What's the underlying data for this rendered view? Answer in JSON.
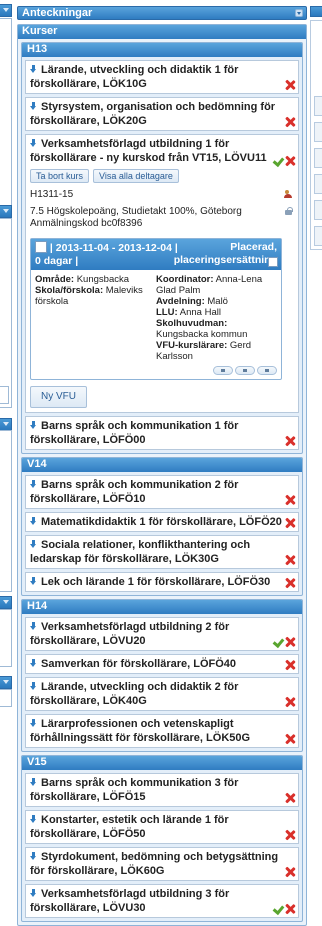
{
  "header": {
    "title": "Anteckningar"
  },
  "panel": {
    "title": "Kurser"
  },
  "terms": [
    {
      "name": "H13",
      "courses": [
        {
          "title": "Lärande, utveckling och didaktik 1 för förskollärare, LÖK10G",
          "approved": false
        },
        {
          "title": "Styrsystem, organisation och bedömning för förskollärare, LÖK20G",
          "approved": false
        }
      ]
    }
  ],
  "expanded_course": {
    "title": "Verksamhetsförlagd utbildning 1 för förskollärare - ny kurskod från VT15, LÖVU11",
    "approved": true,
    "buttons": {
      "remove": "Ta bort kurs",
      "show_participants": "Visa alla deltagare"
    },
    "code": "H1311-15",
    "details": "7.5 Högskolepoäng, Studietakt 100%, Göteborg",
    "registration_code": "Anmälningskod bc0f8396",
    "placement": {
      "dates": "| 2013-11-04 - 2013-12-04 | 0 dagar |",
      "status": "Placerad, placeringsersättning",
      "left": [
        {
          "label": "Område:",
          "value": "Kungsbacka"
        },
        {
          "label": "Skola/förskola:",
          "value": "Maleviks förskola"
        }
      ],
      "right": [
        {
          "label": "Koordinator:",
          "value": "Anna-Lena Glad Palm"
        },
        {
          "label": "Avdelning:",
          "value": "Malö"
        },
        {
          "label": "LLU:",
          "value": "Anna Hall"
        },
        {
          "label": "Skolhuvudman:",
          "value": "Kungsbacka kommun"
        },
        {
          "label": "VFU-kurslärare:",
          "value": "Gerd Karlsson"
        }
      ]
    },
    "new_vfu_button": "Ny VFU"
  },
  "after_expanded": [
    {
      "title": "Barns språk och kommunikation 1 för förskollärare, LÖFÖ00",
      "approved": false
    }
  ],
  "more_terms": [
    {
      "name": "V14",
      "courses": [
        {
          "title": "Barns språk och kommunikation 2 för förskollärare, LÖFÖ10",
          "approved": false
        },
        {
          "title": "Matematikdidaktik 1 för förskollärare, LÖFÖ20",
          "approved": false
        },
        {
          "title": "Sociala relationer, konflikthantering och ledarskap för förskollärare, LÖK30G",
          "approved": false
        },
        {
          "title": "Lek och lärande 1 för förskollärare, LÖFÖ30",
          "approved": false
        }
      ]
    },
    {
      "name": "H14",
      "courses": [
        {
          "title": "Verksamhetsförlagd utbildning 2 för förskollärare, LÖVU20",
          "approved": true
        },
        {
          "title": "Samverkan för förskollärare, LÖFÖ40",
          "approved": false
        },
        {
          "title": "Lärande, utveckling och didaktik 2 för förskollärare, LÖK40G",
          "approved": false
        },
        {
          "title": "Lärarprofessionen och vetenskapligt förhållningssätt för förskollärare, LÖK50G",
          "approved": false
        }
      ]
    },
    {
      "name": "V15",
      "courses": [
        {
          "title": "Barns språk och kommunikation 3 för förskollärare, LÖFÖ15",
          "approved": false
        },
        {
          "title": "Konstarter, estetik och lärande 1 för förskollärare, LÖFÖ50",
          "approved": false
        },
        {
          "title": "Styrdokument, bedömning och betygsättning för förskollärare, LÖK60G",
          "approved": false
        },
        {
          "title": "Verksamhetsförlagd utbildning 3 för förskollärare, LÖVU30",
          "approved": true
        }
      ]
    }
  ]
}
